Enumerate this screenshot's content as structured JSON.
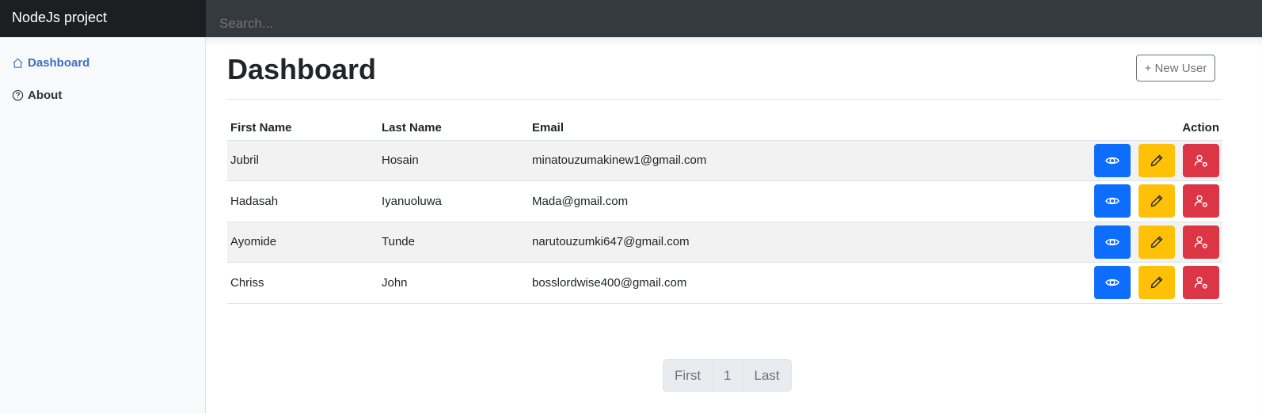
{
  "navbar": {
    "brand": "NodeJs project",
    "search_placeholder": "Search..."
  },
  "sidebar": {
    "items": [
      {
        "label": "Dashboard",
        "icon": "home-icon",
        "active": true
      },
      {
        "label": "About",
        "icon": "question-circle-icon",
        "active": false
      }
    ]
  },
  "main": {
    "title": "Dashboard",
    "new_user_label": "+ New User"
  },
  "table": {
    "columns": [
      "First Name",
      "Last Name",
      "Email",
      "Action"
    ],
    "rows": [
      {
        "first": "Jubril",
        "last": "Hosain",
        "email": "minatouzumakinew1@gmail.com"
      },
      {
        "first": "Hadasah",
        "last": "Iyanuoluwa",
        "email": "Mada@gmail.com"
      },
      {
        "first": "Ayomide",
        "last": "Tunde",
        "email": "narutouzumki647@gmail.com"
      },
      {
        "first": "Chriss",
        "last": "John",
        "email": "bosslordwise400@gmail.com"
      }
    ],
    "action_icons": [
      "eye-icon",
      "pencil-icon",
      "user-remove-icon"
    ]
  },
  "pagination": {
    "first": "First",
    "page": "1",
    "last": "Last"
  },
  "colors": {
    "navbar": "#343a40",
    "brand_bg": "#1c1f22",
    "view": "#0d6efd",
    "edit": "#ffc107",
    "delete": "#dc3545",
    "active_link": "#3d6fc2"
  }
}
